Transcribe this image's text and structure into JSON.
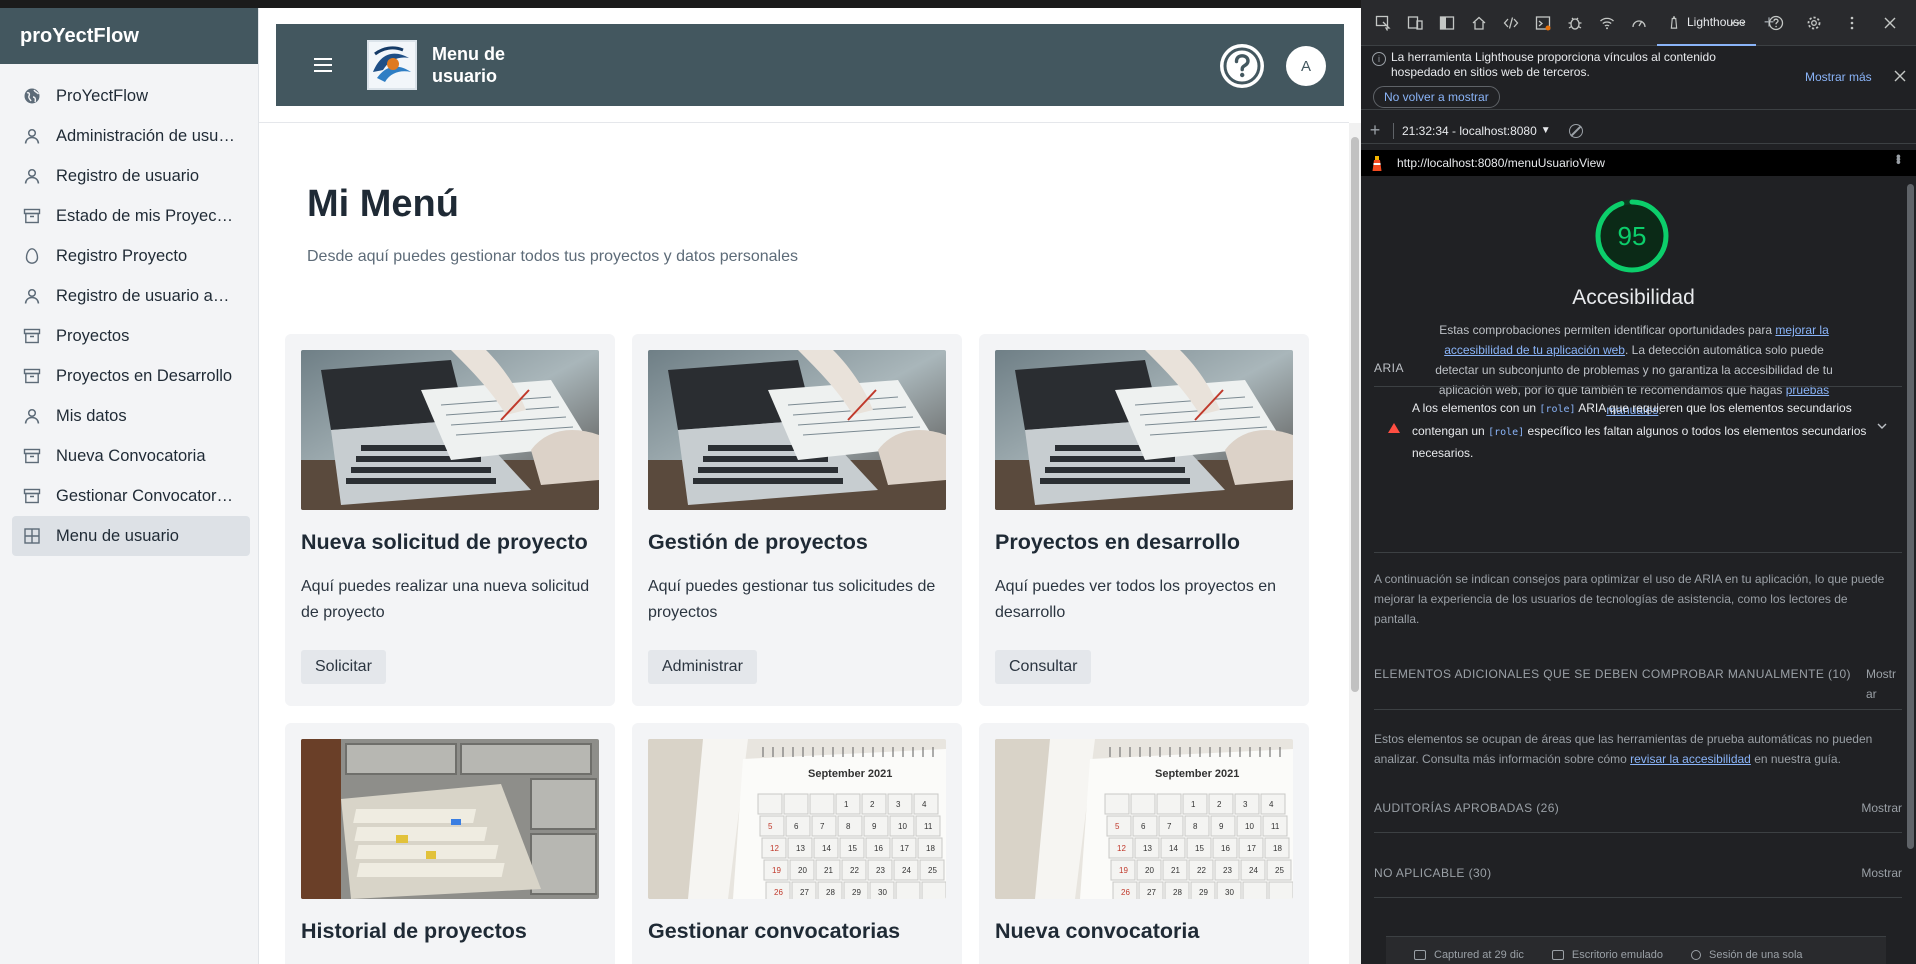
{
  "app": {
    "brand": "proYectFlow",
    "sidebar": {
      "items": [
        {
          "label": "ProYectFlow",
          "icon": "globe-icon",
          "active": false
        },
        {
          "label": "Administración de usu…",
          "icon": "user-icon",
          "active": false
        },
        {
          "label": "Registro de usuario",
          "icon": "user-icon",
          "active": false
        },
        {
          "label": "Estado de mis Proyectos",
          "icon": "archive-icon",
          "active": false
        },
        {
          "label": "Registro Proyecto",
          "icon": "egg-icon",
          "active": false
        },
        {
          "label": "Registro de usuario ad…",
          "icon": "user-icon",
          "active": false
        },
        {
          "label": "Proyectos",
          "icon": "archive-icon",
          "active": false
        },
        {
          "label": "Proyectos en Desarrollo",
          "icon": "archive-icon",
          "active": false
        },
        {
          "label": "Mis datos",
          "icon": "user-icon",
          "active": false
        },
        {
          "label": "Nueva Convocatoria",
          "icon": "archive-icon",
          "active": false
        },
        {
          "label": "Gestionar Convocatorias",
          "icon": "archive-icon",
          "active": false
        },
        {
          "label": "Menu de usuario",
          "icon": "grid-icon",
          "active": true
        }
      ]
    },
    "topbar": {
      "title": "Menu de usuario",
      "help_icon": "question-icon",
      "avatar_initial": "A"
    },
    "page": {
      "title": "Mi Menú",
      "subtitle": "Desde aquí puedes gestionar todos tus proyectos y datos personales"
    },
    "cards": [
      {
        "title": "Nueva solicitud de proyecto",
        "desc": "Aquí puedes realizar una nueva solicitud de proyecto",
        "button": "Solicitar",
        "image": "laptop-desk-image"
      },
      {
        "title": "Gestión de proyectos",
        "desc": "Aquí puedes gestionar tus solicitudes de proyectos",
        "button": "Administrar",
        "image": "laptop-desk-image"
      },
      {
        "title": "Proyectos en desarrollo",
        "desc": "Aquí puedes ver todos los proyectos en desarrollo",
        "button": "Consultar",
        "image": "laptop-desk-image"
      },
      {
        "title": "Historial de proyectos",
        "image": "file-drawer-image"
      },
      {
        "title": "Gestionar convocatorias",
        "image": "calendar-image",
        "calendar_month": "September 2021"
      },
      {
        "title": "Nueva convocatoria",
        "image": "calendar-image",
        "calendar_month": "September 2021"
      }
    ]
  },
  "devtools": {
    "active_tab": "Lighthouse",
    "info_banner": {
      "text": "La herramienta Lighthouse proporciona vínculos al contenido hospedado en sitios web de terceros.",
      "more": "Mostrar más",
      "dismiss": "No volver a mostrar"
    },
    "report_select": "21:32:34 - localhost:8080",
    "url": "http://localhost:8080/menuUsuarioView",
    "score": "95",
    "score_color": "#0cce6b",
    "category": "Accesibilidad",
    "category_desc_1": "Estas comprobaciones permiten identificar oportunidades para ",
    "category_desc_link1": "mejorar la accesibilidad de tu aplicación web",
    "category_desc_2": ". La detección automática solo puede detectar un subconjunto de problemas y no garantiza la accesibilidad de tu aplicación web, por lo que también te recomendamos que hagas ",
    "category_desc_link2": "pruebas manuales",
    "category_desc_3": ".",
    "aria_label": "ARIA",
    "audit_a": "A los elementos con un ",
    "audit_code1": "[role]",
    "audit_b": " ARIA que requieren que los elementos secundarios contengan un ",
    "audit_code2": "[role]",
    "audit_c": " específico les faltan algunos o todos los elementos secundarios necesarios.",
    "aria_tip": "A continuación se indican consejos para optimizar el uso de ARIA en tu aplicación, lo que puede mejorar la experiencia de los usuarios de tecnologías de asistencia, como los lectores de pantalla.",
    "manual_head": "ELEMENTOS ADICIONALES QUE SE DEBEN COMPROBAR MANUALMENTE (10)",
    "manual_show": "Mostrar",
    "manual_desc_1": "Estos elementos se ocupan de áreas que las herramientas de prueba automáticas no pueden analizar. Consulta más información sobre cómo ",
    "manual_desc_link": "revisar la accesibilidad",
    "manual_desc_2": " en nuestra guía.",
    "passed_head": "AUDITORÍAS APROBADAS (26)",
    "passed_show": "Mostrar",
    "na_head": "NO APLICABLE (30)",
    "na_show": "Mostrar",
    "footer": {
      "captured": "Captured at 29 dic",
      "device": "Escritorio emulado",
      "session": "Sesión de una sola"
    }
  }
}
